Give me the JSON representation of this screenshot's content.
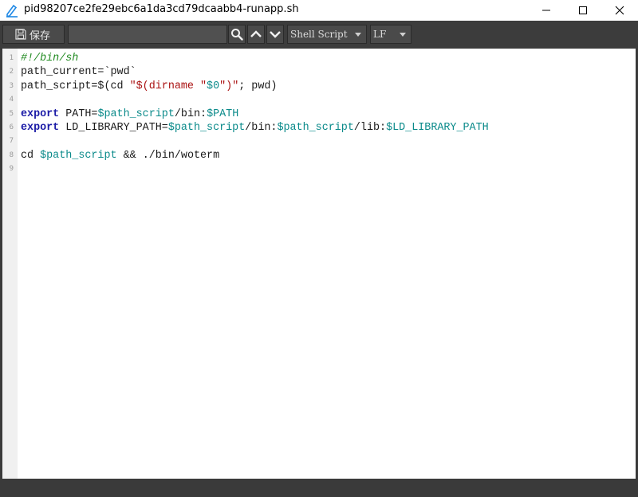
{
  "window": {
    "title": "pid98207ce2fe29ebc6a1da3cd79dcaabb4-runapp.sh",
    "icon": "edit-document-icon"
  },
  "toolbar": {
    "save_label": "保存",
    "search": {
      "value": "",
      "placeholder": ""
    },
    "language": "Shell Script",
    "line_ending": "LF"
  },
  "editor": {
    "lines": [
      {
        "n": "1",
        "tokens": [
          {
            "t": "#!/bin/sh",
            "c": "c-com"
          }
        ]
      },
      {
        "n": "2",
        "tokens": [
          {
            "t": "path_current=`pwd`",
            "c": ""
          }
        ]
      },
      {
        "n": "3",
        "tokens": [
          {
            "t": "path_script=$(cd ",
            "c": ""
          },
          {
            "t": "\"$(dirname \"",
            "c": "c-str"
          },
          {
            "t": "$0",
            "c": "c-var"
          },
          {
            "t": "\")\"",
            "c": "c-str"
          },
          {
            "t": "; pwd)",
            "c": ""
          }
        ]
      },
      {
        "n": "4",
        "tokens": []
      },
      {
        "n": "5",
        "tokens": [
          {
            "t": "export",
            "c": "c-kw"
          },
          {
            "t": " PATH=",
            "c": ""
          },
          {
            "t": "$path_script",
            "c": "c-var"
          },
          {
            "t": "/bin:",
            "c": ""
          },
          {
            "t": "$PATH",
            "c": "c-var"
          }
        ]
      },
      {
        "n": "6",
        "tokens": [
          {
            "t": "export",
            "c": "c-kw"
          },
          {
            "t": " LD_LIBRARY_PATH=",
            "c": ""
          },
          {
            "t": "$path_script",
            "c": "c-var"
          },
          {
            "t": "/bin:",
            "c": ""
          },
          {
            "t": "$path_script",
            "c": "c-var"
          },
          {
            "t": "/lib:",
            "c": ""
          },
          {
            "t": "$LD_LIBRARY_PATH",
            "c": "c-var"
          }
        ]
      },
      {
        "n": "7",
        "tokens": []
      },
      {
        "n": "8",
        "tokens": [
          {
            "t": "cd ",
            "c": ""
          },
          {
            "t": "$path_script",
            "c": "c-var"
          },
          {
            "t": " && ./bin/woterm",
            "c": ""
          }
        ]
      },
      {
        "n": "9",
        "tokens": []
      }
    ]
  },
  "colors": {
    "toolbar_bg": "#3c3c3c",
    "keyword": "#1a1aa6",
    "comment": "#228b22",
    "string": "#aa1111",
    "variable": "#0a8a8a"
  }
}
